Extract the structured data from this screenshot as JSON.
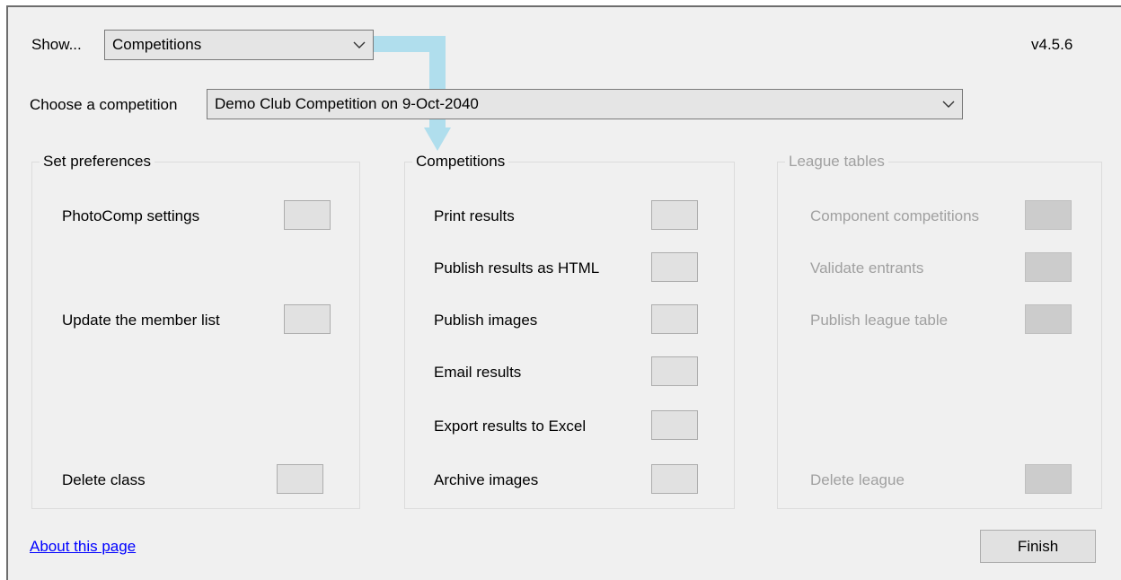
{
  "header": {
    "show_label": "Show...",
    "show_value": "Competitions",
    "version": "v4.5.6"
  },
  "competition": {
    "label": "Choose a competition",
    "value": "Demo Club Competition on 9-Oct-2040"
  },
  "preferences": {
    "title": "Set preferences",
    "items": [
      "PhotoComp settings",
      "Update the member list",
      "Delete class"
    ]
  },
  "competitions": {
    "title": "Competitions",
    "items": [
      "Print results",
      "Publish results as HTML",
      "Publish images",
      "Email results",
      "Export results to Excel",
      "Archive images"
    ]
  },
  "league": {
    "title": "League tables",
    "items": [
      "Component competitions",
      "Validate entrants",
      "Publish league table",
      "Delete league"
    ]
  },
  "footer": {
    "about_link": "About this page",
    "finish_label": "Finish"
  },
  "colors": {
    "window_bg": "#f0f0f0",
    "link": "#0000ff",
    "arrow": "#a9dcec",
    "disabled_text": "#a0a0a0"
  },
  "icons": {
    "dropdown": "chevron-down-icon",
    "hint": "arrow-down-icon"
  }
}
